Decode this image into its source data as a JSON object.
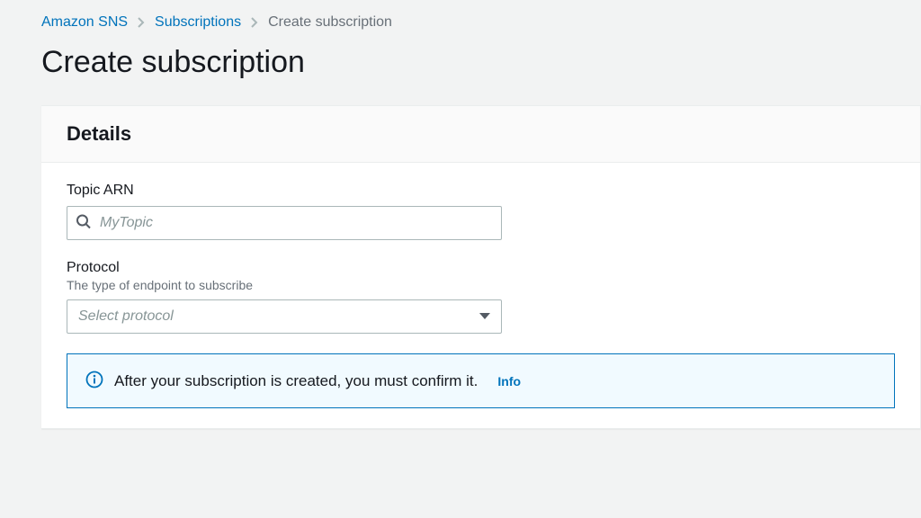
{
  "breadcrumb": {
    "root": "Amazon SNS",
    "middle": "Subscriptions",
    "current": "Create subscription"
  },
  "page_title": "Create subscription",
  "details": {
    "heading": "Details",
    "topic_arn": {
      "label": "Topic ARN",
      "placeholder": "MyTopic"
    },
    "protocol": {
      "label": "Protocol",
      "hint": "The type of endpoint to subscribe",
      "placeholder": "Select protocol"
    },
    "info_banner": {
      "text": "After your subscription is created, you must confirm it.",
      "link": "Info"
    }
  }
}
